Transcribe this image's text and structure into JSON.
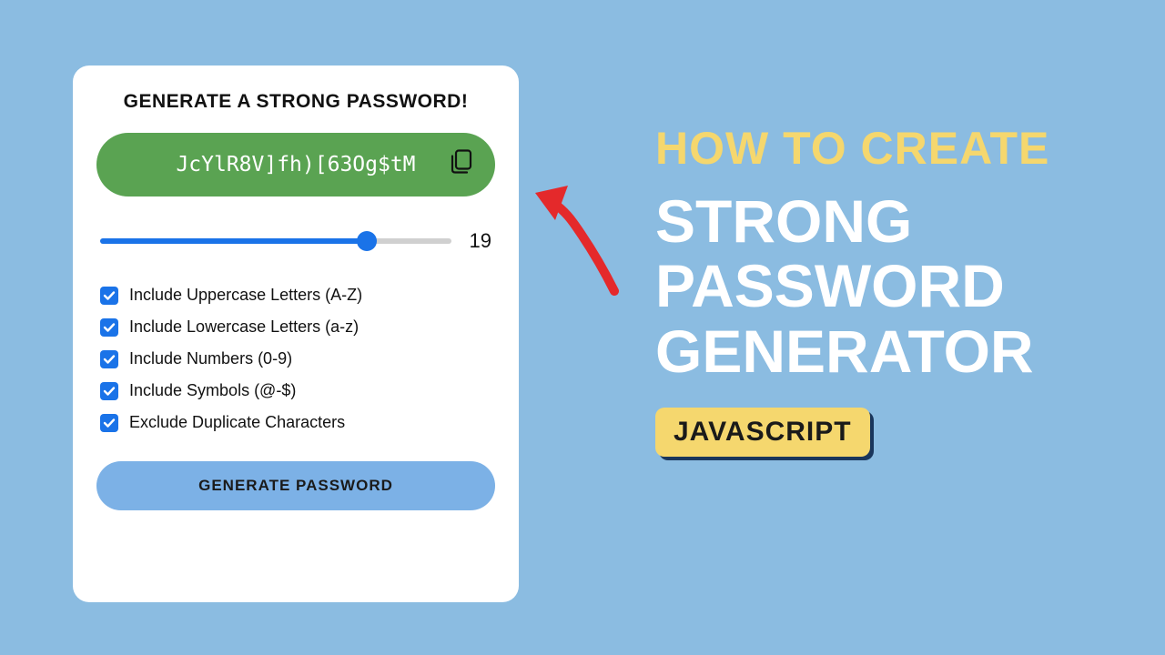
{
  "card": {
    "title": "GENERATE A STRONG PASSWORD!",
    "password": "JcYlR8V]fh)[63Og$tM",
    "slider_value": "19",
    "options": [
      {
        "label": "Include Uppercase Letters (A-Z)",
        "checked": true
      },
      {
        "label": "Include Lowercase Letters (a-z)",
        "checked": true
      },
      {
        "label": "Include Numbers (0-9)",
        "checked": true
      },
      {
        "label": "Include Symbols (@-$)",
        "checked": true
      },
      {
        "label": "Exclude Duplicate Characters",
        "checked": true
      }
    ],
    "generate_label": "GENERATE PASSWORD"
  },
  "headline": {
    "line1": "HOW TO CREATE",
    "line2": "STRONG PASSWORD GENERATOR",
    "badge": "JAVASCRIPT"
  },
  "colors": {
    "bg": "#8bbce1",
    "accent_blue": "#1a73e8",
    "pill_green": "#5aa352",
    "btn_blue": "#7cb1e6",
    "yellow": "#f5d76e",
    "arrow_red": "#e4292b"
  }
}
